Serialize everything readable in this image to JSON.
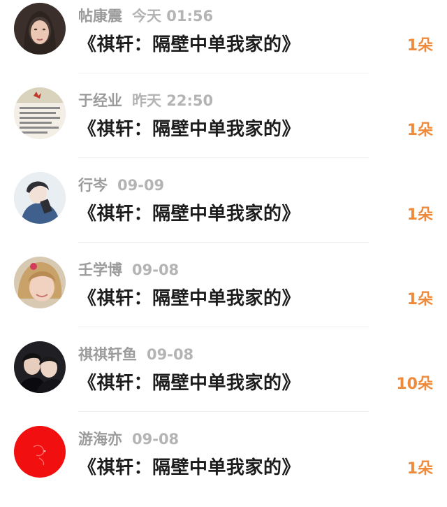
{
  "comments": [
    {
      "name": "帖康震",
      "time": "今天 01:56",
      "title": "《祺轩：隔壁中单我家的》",
      "gift": "1朵",
      "avatar_icon": "avatar-woman-dark-hair-icon"
    },
    {
      "name": "于经业",
      "time": "昨天 22:50",
      "title": "《祺轩：隔壁中单我家的》",
      "gift": "1朵",
      "avatar_icon": "avatar-text-card-icon"
    },
    {
      "name": "行岑",
      "time": "09-09",
      "title": "《祺轩：隔壁中单我家的》",
      "gift": "1朵",
      "avatar_icon": "avatar-anime-boy-icon"
    },
    {
      "name": "壬学博",
      "time": "09-08",
      "title": "《祺轩：隔壁中单我家的》",
      "gift": "1朵",
      "avatar_icon": "avatar-little-girl-icon"
    },
    {
      "name": "祺祺轩鱼",
      "time": "09-08",
      "title": "《祺轩：隔壁中单我家的》",
      "gift": "10朵",
      "avatar_icon": "avatar-two-boys-icon"
    },
    {
      "name": "游海亦",
      "time": "09-08",
      "title": "《祺轩：隔壁中单我家的》",
      "gift": "1朵",
      "avatar_icon": "avatar-red-circle-icon"
    }
  ],
  "colors": {
    "gift": "#ee8a3c",
    "name": "#9b9b9b",
    "time": "#b4b4b4",
    "title": "#1c1c1c"
  }
}
